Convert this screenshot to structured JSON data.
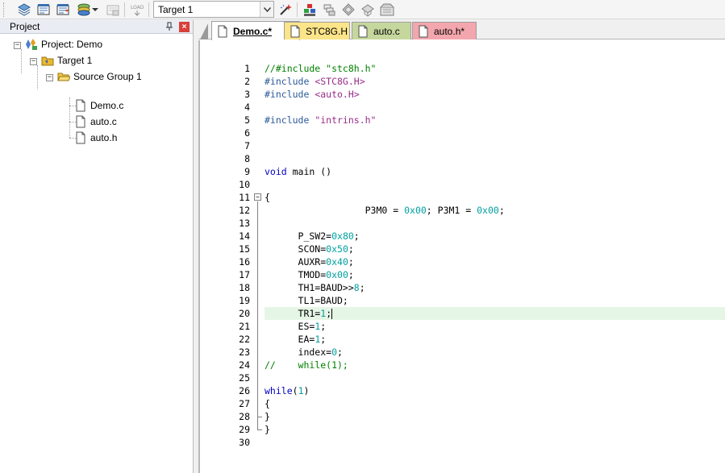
{
  "toolbar": {
    "target_value": "Target 1",
    "buttons": [
      "stack-icon",
      "build-icon",
      "rebuild-icon",
      "batch-build-icon",
      "stop-build-icon",
      "load-icon",
      "wand-icon",
      "manage-components-icon",
      "books-icon",
      "diamond-icon",
      "pack-icon",
      "multi-project-icon"
    ],
    "load_label": "LOAD"
  },
  "project_panel": {
    "title": "Project",
    "pin_glyph": "❑",
    "close_glyph": "×",
    "tree": {
      "project": "Project: Demo",
      "target": "Target 1",
      "group": "Source Group 1",
      "files": [
        "Demo.c",
        "auto.c",
        "auto.h"
      ]
    }
  },
  "editor": {
    "tabs": [
      {
        "label": "Demo.c*",
        "style": "active"
      },
      {
        "label": "STC8G.H",
        "style": "yellow"
      },
      {
        "label": "auto.c",
        "style": "green"
      },
      {
        "label": "auto.h*",
        "style": "red"
      }
    ],
    "highlight_line": 20,
    "lines": [
      "//#include \"stc8h.h\"",
      "#include <STC8G.H>",
      "#include <auto.H>",
      "",
      "#include \"intrins.h\"",
      "",
      "",
      "",
      "void main ()",
      "",
      "{",
      "                  P3M0 = 0x00; P3M1 = 0x00;",
      "",
      "      P_SW2=0x80;",
      "      SCON=0x50;",
      "      AUXR=0x40;",
      "      TMOD=0x00;",
      "      TH1=BAUD>>8;",
      "      TL1=BAUD;",
      "      TR1=1;",
      "      ES=1;",
      "      EA=1;",
      "      index=0;",
      "//    while(1);",
      "",
      "while(1)",
      "{",
      "}",
      "}",
      ""
    ]
  },
  "colors": {
    "comment": "#008000",
    "preprocessor": "#2c5a9a",
    "number": "#00a0a0",
    "keyword": "#0000c0",
    "line_highlight": "#e6f6e6"
  }
}
